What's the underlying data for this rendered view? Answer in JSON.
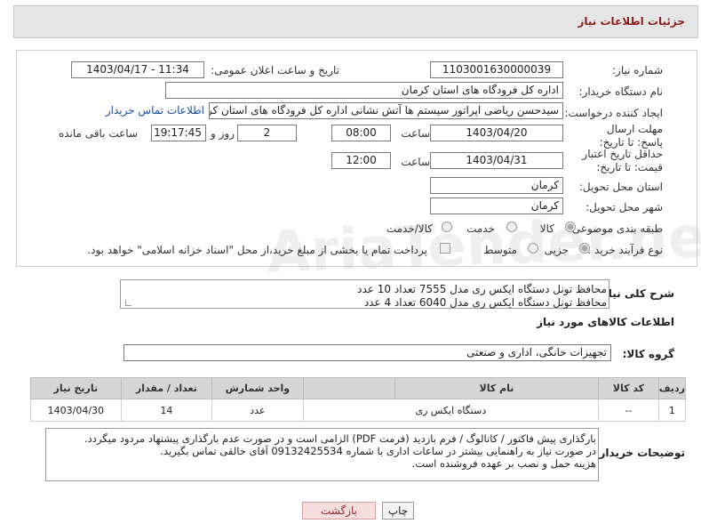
{
  "header": {
    "title": "جزئیات اطلاعات نیاز"
  },
  "watermark": "AriaTender.neT",
  "form": {
    "need_number": {
      "label": "شماره نیاز:",
      "value": "1103001630000039"
    },
    "announce": {
      "label": "تاریخ و ساعت اعلان عمومی:",
      "value": "1403/04/17 - 11:34"
    },
    "buyer_org": {
      "label": "نام دستگاه خریدار:",
      "value": "اداره کل فرودگاه های استان کرمان"
    },
    "requester": {
      "label": "ایجاد کننده درخواست:",
      "value": "سیدحسن ریاضی اپراتور سیستم ها آتش نشانی اداره کل فرودگاه های استان کرمان",
      "contact_link": "اطلاعات تماس خریدار"
    },
    "deadline": {
      "label": "مهلت ارسال پاسخ: تا تاریخ:",
      "date": "1403/04/20",
      "time_label": "ساعت",
      "time": "08:00",
      "days": "2",
      "days_label": "روز و",
      "remaining": "19:17:45",
      "remaining_label": "ساعت باقی مانده"
    },
    "validity": {
      "label": "حداقل تاریخ اعتبار قیمت: تا تاریخ:",
      "date": "1403/04/31",
      "time_label": "ساعت",
      "time": "12:00"
    },
    "province": {
      "label": "استان محل تحویل:",
      "value": "کرمان"
    },
    "city": {
      "label": "شهر محل تحویل:",
      "value": "کرمان"
    },
    "category": {
      "label": "طبقه بندی موضوعی:",
      "options": [
        "کالا",
        "خدمت",
        "کالا/خدمت"
      ]
    },
    "purchase": {
      "label": "نوع فرآیند خرید :",
      "options": [
        "جزیی",
        "متوسط"
      ],
      "payment_note": "پرداخت تمام یا بخشی از مبلغ خرید،از محل \"اسناد خزانه اسلامی\" خواهد بود."
    }
  },
  "general_desc": {
    "label": "شرح کلی نیاز:",
    "lines": [
      "محافظ تونل دستگاه ایکس ری مدل 7555 تعداد 10 عدد",
      "محافظ تونل دستگاه ایکس ری مدل 6040 تعداد 4 عدد"
    ]
  },
  "goods_section": {
    "title": "اطلاعات کالاهای مورد نیاز",
    "group_label": "گروه کالا:",
    "group_value": "تجهیزات خانگی، اداری و صنعتی"
  },
  "table": {
    "headers": [
      "ردیف",
      "کد کالا",
      "نام کالا",
      "واحد شمارش",
      "تعداد / مقدار",
      "تاریخ نیاز"
    ],
    "rows": [
      [
        "1",
        "--",
        "دستگاه ایکس ری",
        "عدد",
        "14",
        "1403/04/30"
      ]
    ]
  },
  "buyer_notes": {
    "label": "توضیحات خریدار:",
    "lines": [
      "بارگذاری پیش فاکتور / کاتالوگ / فرم بازدید (فرمت PDF) الزامی است و در صورت عدم بارگذاری پیشنهاد مردود میگردد.",
      "در صورت نیاز به راهنمایی بیشتر در ساعات اداری با شماره 09132425534 آقای خالقی  تماس بگیرید.",
      "هزینه حمل و نصب بر عهده فروشنده است."
    ]
  },
  "buttons": {
    "print": "چاپ",
    "back": "بازگشت"
  }
}
